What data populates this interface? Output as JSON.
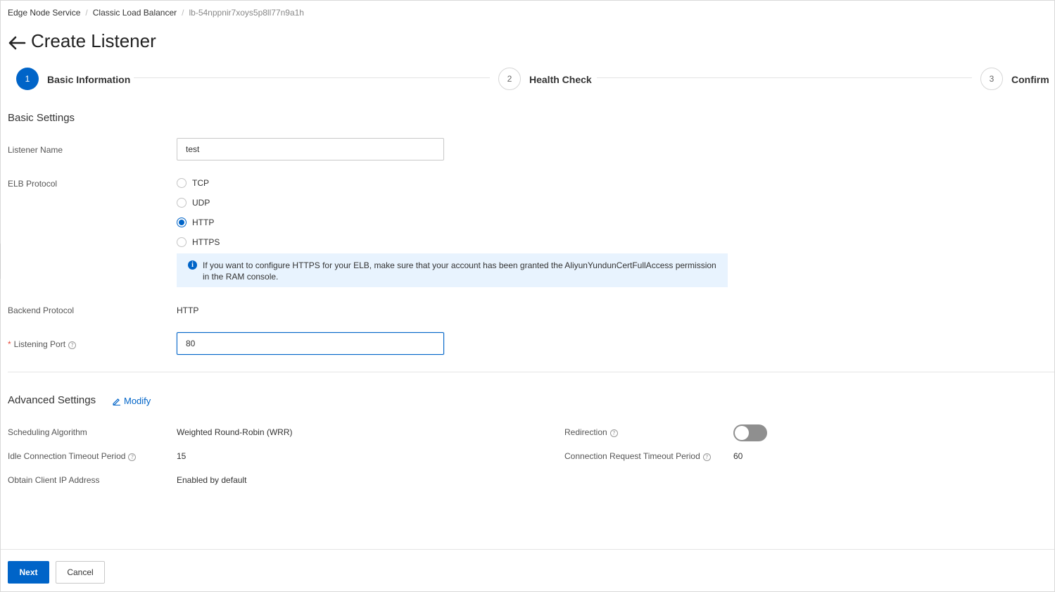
{
  "breadcrumb": {
    "items": [
      "Edge Node Service",
      "Classic Load Balancer"
    ],
    "current": "lb-54nppnir7xoys5p8ll77n9a1h",
    "separator": "/"
  },
  "page": {
    "title": "Create Listener",
    "back_icon": "arrow-left-icon"
  },
  "steps": [
    {
      "number": "1",
      "label": "Basic Information",
      "state": "active"
    },
    {
      "number": "2",
      "label": "Health Check",
      "state": "inactive"
    },
    {
      "number": "3",
      "label": "Confirm",
      "state": "inactive"
    }
  ],
  "basic": {
    "title": "Basic Settings",
    "listener_name": {
      "label": "Listener Name",
      "value": "test"
    },
    "elb_protocol": {
      "label": "ELB Protocol",
      "options": [
        "TCP",
        "UDP",
        "HTTP",
        "HTTPS"
      ],
      "selected": "HTTP",
      "info": "If you want to configure HTTPS for your ELB, make sure that your account has been granted the AliyunYundunCertFullAccess permission in the RAM console."
    },
    "backend_protocol": {
      "label": "Backend Protocol",
      "value": "HTTP"
    },
    "listening_port": {
      "label": "Listening Port",
      "required_mark": "*",
      "value": "80"
    }
  },
  "advanced": {
    "title": "Advanced Settings",
    "modify_label": "Modify",
    "scheduling_algorithm": {
      "label": "Scheduling Algorithm",
      "value": "Weighted Round-Robin (WRR)"
    },
    "idle_timeout": {
      "label": "Idle Connection Timeout Period",
      "value": "15"
    },
    "client_ip": {
      "label": "Obtain Client IP Address",
      "value": "Enabled by default"
    },
    "redirection": {
      "label": "Redirection",
      "enabled": false
    },
    "request_timeout": {
      "label": "Connection Request Timeout Period",
      "value": "60"
    }
  },
  "footer": {
    "next_label": "Next",
    "cancel_label": "Cancel"
  },
  "colors": {
    "primary": "#0064c8",
    "info_bg": "#e8f3fe",
    "required": "#e84738",
    "toggle_off": "#8f8f8f"
  }
}
